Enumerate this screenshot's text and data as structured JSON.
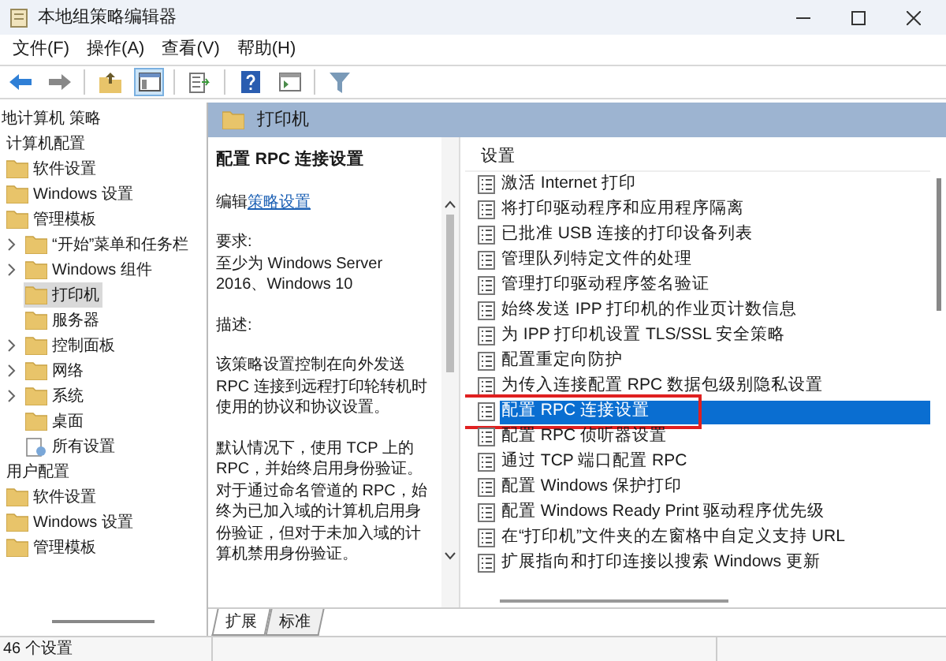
{
  "window": {
    "title": "本地组策略编辑器"
  },
  "menu": [
    "文件(F)",
    "操作(A)",
    "查看(V)",
    "帮助(H)"
  ],
  "toolbar": [
    {
      "kind": "back",
      "selected": false
    },
    {
      "kind": "forward",
      "selected": false
    },
    {
      "kind": "up",
      "selected": false
    },
    {
      "kind": "console",
      "selected": true
    },
    {
      "kind": "export",
      "selected": false
    },
    {
      "kind": "help",
      "selected": false
    },
    {
      "kind": "pane",
      "selected": false
    },
    {
      "kind": "filter",
      "selected": false
    }
  ],
  "tree": [
    {
      "label": "地计算机 策略",
      "selected": false,
      "children": [
        {
          "label": "计算机配置",
          "selected": false,
          "children": [
            {
              "label": "软件设置",
              "kind": "folder",
              "selected": false
            },
            {
              "label": "Windows 设置",
              "kind": "folder",
              "selected": false
            },
            {
              "label": "管理模板",
              "kind": "folder",
              "selected": false,
              "children": [
                {
                  "label": "“开始”菜单和任务栏",
                  "kind": "folder",
                  "selected": false,
                  "collapsed": true
                },
                {
                  "label": "Windows 组件",
                  "kind": "folder",
                  "selected": false,
                  "collapsed": true
                },
                {
                  "label": "打印机",
                  "kind": "folder",
                  "selected": true,
                  "collapsed": false
                },
                {
                  "label": "服务器",
                  "kind": "folder",
                  "selected": false,
                  "collapsed": false
                },
                {
                  "label": "控制面板",
                  "kind": "folder",
                  "selected": false,
                  "collapsed": true
                },
                {
                  "label": "网络",
                  "kind": "folder",
                  "selected": false,
                  "collapsed": true
                },
                {
                  "label": "系统",
                  "kind": "folder",
                  "selected": false,
                  "collapsed": true
                },
                {
                  "label": "桌面",
                  "kind": "folder",
                  "selected": false,
                  "collapsed": false
                },
                {
                  "label": "所有设置",
                  "kind": "settings",
                  "selected": false,
                  "collapsed": false
                }
              ]
            }
          ]
        },
        {
          "label": "用户配置",
          "selected": false,
          "children": [
            {
              "label": "软件设置",
              "kind": "folder",
              "selected": false
            },
            {
              "label": "Windows 设置",
              "kind": "folder",
              "selected": false
            },
            {
              "label": "管理模板",
              "kind": "folder",
              "selected": false
            }
          ]
        }
      ]
    }
  ],
  "header": {
    "title": "打印机"
  },
  "details": {
    "title": "配置 RPC 连接设置",
    "edit_prefix": "编辑",
    "edit_link": "策略设置",
    "blocks": [
      [
        "要求:",
        "至少为 Windows Server 2016、Windows 10"
      ],
      [
        "描述:"
      ],
      [
        "该策略设置控制在向外发送 RPC 连接到远程打印轮转机时使用的协议和协议设置。"
      ],
      [
        "默认情况下，使用 TCP 上的 RPC，并始终启用身份验证。对于通过命名管道的 RPC，始终为已加入域的计算机启用身份验证，但对于未加入域的计算机禁用身份验证。"
      ]
    ]
  },
  "settings": {
    "column": "设置",
    "rows": [
      {
        "label": "激活 Internet 打印",
        "selected": false
      },
      {
        "label": "将打印驱动程序和应用程序隔离",
        "selected": false
      },
      {
        "label": "已批准 USB 连接的打印设备列表",
        "selected": false
      },
      {
        "label": "管理队列特定文件的处理",
        "selected": false
      },
      {
        "label": "管理打印驱动程序签名验证",
        "selected": false
      },
      {
        "label": "始终发送 IPP 打印机的作业页计数信息",
        "selected": false
      },
      {
        "label": "为 IPP 打印机设置 TLS/SSL 安全策略",
        "selected": false
      },
      {
        "label": "配置重定向防护",
        "selected": false
      },
      {
        "label": "为传入连接配置 RPC 数据包级别隐私设置",
        "selected": false
      },
      {
        "label": "配置 RPC 连接设置",
        "selected": true
      },
      {
        "label": "配置 RPC 侦听器设置",
        "selected": false
      },
      {
        "label": "通过 TCP 端口配置 RPC",
        "selected": false
      },
      {
        "label": "配置 Windows 保护打印",
        "selected": false
      },
      {
        "label": "配置 Windows Ready Print 驱动程序优先级",
        "selected": false
      },
      {
        "label": "在“打印机”文件夹的左窗格中自定义支持 URL",
        "selected": false
      },
      {
        "label": "扩展指向和打印连接以搜索 Windows 更新",
        "selected": false
      }
    ]
  },
  "tabs": [
    {
      "label": "扩展",
      "selected": true
    },
    {
      "label": "标准",
      "selected": false
    }
  ],
  "status_bar": {
    "text": "46 个设置"
  }
}
